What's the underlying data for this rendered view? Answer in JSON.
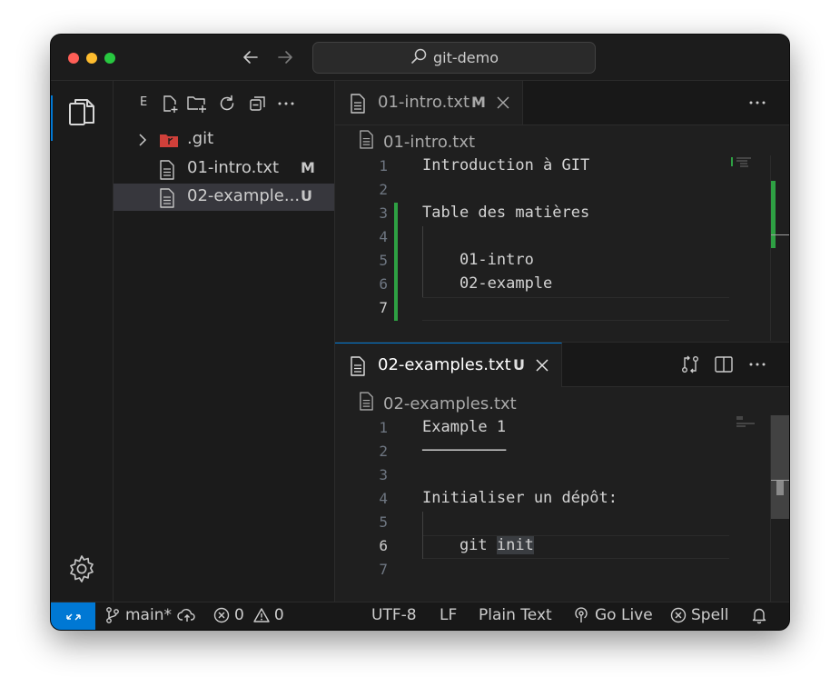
{
  "titlebar": {
    "search_label": "git-demo",
    "traffic_lights": [
      "#ff5f57",
      "#febc2e",
      "#28c840"
    ]
  },
  "activity_bar": {
    "items": [
      "explorer-icon",
      "gear-icon"
    ],
    "active_color": "#0078d4"
  },
  "explorer": {
    "title": "E",
    "actions": [
      "new-file-icon",
      "new-folder-icon",
      "refresh-icon",
      "collapse-all-icon",
      "more-icon"
    ],
    "items": [
      {
        "name": ".git",
        "type": "folder",
        "badge": ""
      },
      {
        "name": "01-intro.txt",
        "type": "file",
        "badge": "M"
      },
      {
        "name": "02-example...",
        "type": "file",
        "badge": "U"
      }
    ]
  },
  "editor_top": {
    "tab": {
      "label": "01-intro.txt",
      "badge": "M"
    },
    "breadcrumb": "01-intro.txt",
    "lines": [
      {
        "n": "1",
        "text": "Introduction à GIT"
      },
      {
        "n": "2",
        "text": ""
      },
      {
        "n": "3",
        "text": "Table des matières"
      },
      {
        "n": "4",
        "text": ""
      },
      {
        "n": "5",
        "text": "    01-intro"
      },
      {
        "n": "6",
        "text": "    02-example"
      },
      {
        "n": "7",
        "text": ""
      }
    ]
  },
  "editor_bottom": {
    "tab": {
      "label": "02-examples.txt",
      "badge": "U"
    },
    "breadcrumb": "02-examples.txt",
    "actions": [
      "open-changes-icon",
      "split-editor-icon",
      "more-icon"
    ],
    "lines": [
      {
        "n": "1",
        "text": "Example 1"
      },
      {
        "n": "2",
        "text": "─────────"
      },
      {
        "n": "3",
        "text": ""
      },
      {
        "n": "4",
        "text": "Initialiser un dépôt:"
      },
      {
        "n": "5",
        "text": ""
      },
      {
        "n": "6",
        "text": "    git ",
        "highlight": "init"
      },
      {
        "n": "7",
        "text": ""
      }
    ]
  },
  "statusbar": {
    "branch": "main*",
    "errors": "0",
    "warnings": "0",
    "encoding": "UTF-8",
    "eol": "LF",
    "language": "Plain Text",
    "go_live": "Go Live",
    "spell": "Spell",
    "remote_color": "#0078d4"
  }
}
